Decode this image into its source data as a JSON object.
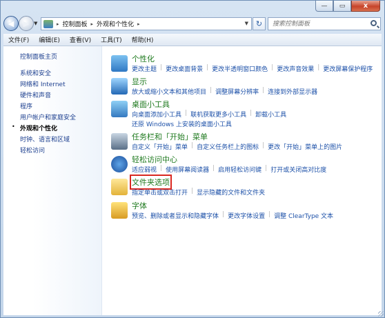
{
  "window": {
    "caption_buttons": [
      "minimize",
      "maximize",
      "close"
    ],
    "close_symbol": "x",
    "minimize_symbol": "—",
    "maximize_symbol": "▭"
  },
  "nav": {
    "back_icon": "back-arrow-icon",
    "back_symbol": "◀",
    "forward_symbol": "▶",
    "dropdown_symbol": "▼",
    "address": {
      "crumbs": [
        "控制面板",
        "外观和个性化"
      ],
      "separator": "▸"
    },
    "refresh_symbol": "↻",
    "search_placeholder": "搜索控制面板"
  },
  "menu": [
    "文件(F)",
    "编辑(E)",
    "查看(V)",
    "工具(T)",
    "帮助(H)"
  ],
  "sidebar": {
    "home": "控制面板主页",
    "items": [
      "系统和安全",
      "网络和 Internet",
      "硬件和声音",
      "程序",
      "用户帐户和家庭安全",
      "外观和个性化",
      "时钟、语言和区域",
      "轻松访问"
    ],
    "current": "外观和个性化",
    "bullet": "•"
  },
  "categories": [
    {
      "title": "个性化",
      "links": [
        "更改主题",
        "更改桌面背景",
        "更改半透明窗口颜色",
        "更改声音效果",
        "更改屏幕保护程序"
      ]
    },
    {
      "title": "显示",
      "links": [
        "放大或缩小文本和其他项目",
        "调整屏幕分辨率",
        "连接到外部显示器"
      ]
    },
    {
      "title": "桌面小工具",
      "links": [
        "向桌面添加小工具",
        "联机获取更多小工具",
        "卸载小工具"
      ],
      "links2": [
        "还原 Windows 上安装的桌面小工具"
      ]
    },
    {
      "title": "任务栏和「开始」菜单",
      "links": [
        "自定义「开始」菜单",
        "自定义任务栏上的图标",
        "更改「开始」菜单上的图片"
      ]
    },
    {
      "title": "轻松访问中心",
      "links": [
        "适应弱视",
        "使用屏幕阅读器",
        "启用轻松访问键",
        "打开或关闭高对比度"
      ]
    },
    {
      "title": "文件夹选项",
      "links": [
        "指定单击或双击打开",
        "显示隐藏的文件和文件夹"
      ]
    },
    {
      "title": "字体",
      "links": [
        "预览、删除或者显示和隐藏字体",
        "更改字体设置",
        "调整 ClearType 文本"
      ]
    }
  ],
  "highlight": "文件夹选项",
  "colors": {
    "category_title": "#1f7a1f",
    "link": "#1c50a8",
    "highlight_box": "#d9271f"
  }
}
